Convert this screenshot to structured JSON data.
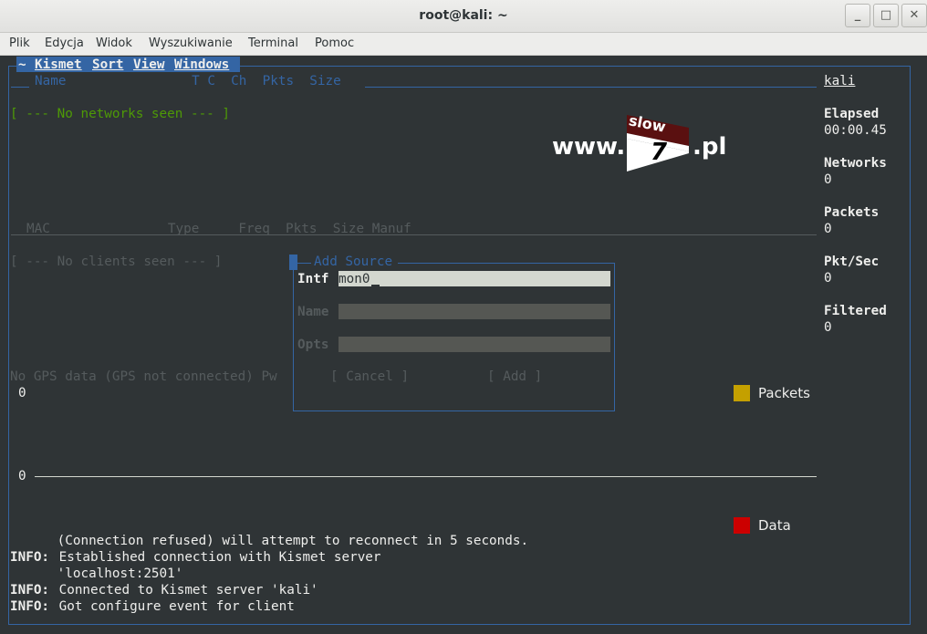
{
  "window": {
    "title": "root@kali: ~",
    "buttons": [
      "_",
      "□",
      "✕"
    ]
  },
  "menu": [
    "Plik",
    "Edycja",
    "Widok",
    "Wyszukiwanie",
    "Terminal",
    "Pomoc"
  ],
  "kismet": {
    "menubar": "~ Kismet Sort View Windows",
    "menu_items": [
      "~",
      "Kismet",
      "Sort",
      "View",
      "Windows"
    ],
    "network_headers": "Name                T C  Ch  Pkts  Size",
    "no_networks": "[ --- No networks seen --- ]",
    "client_headers": "MAC               Type     Freq  Pkts  Size Manuf",
    "no_clients": "[ --- No clients seen --- ]",
    "gps": "No GPS data (GPS not connected) Pw",
    "graph": {
      "top_value": "0",
      "bottom_value": "0",
      "legend": [
        {
          "label": "Packets",
          "color": "#c4a000"
        },
        {
          "label": "Data",
          "color": "#cc0000"
        }
      ]
    },
    "sidebar": {
      "host": "kali",
      "stats": [
        {
          "label": "Elapsed",
          "value": "00:00.45"
        },
        {
          "label": "Networks",
          "value": "0"
        },
        {
          "label": "Packets",
          "value": "0"
        },
        {
          "label": "Pkt/Sec",
          "value": "0"
        },
        {
          "label": "Filtered",
          "value": "0"
        }
      ]
    },
    "dialog": {
      "title": "Add Source",
      "fields": [
        {
          "label": "Intf",
          "value": "mon0"
        },
        {
          "label": "Name",
          "value": ""
        },
        {
          "label": "Opts",
          "value": ""
        }
      ],
      "cancel": "[ Cancel ]",
      "add": "[ Add ]"
    },
    "log": [
      {
        "prefix": "",
        "text": "      (Connection refused) will attempt to reconnect in 5 seconds."
      },
      {
        "prefix": "INFO:",
        "text": " Established connection with Kismet server"
      },
      {
        "prefix": "",
        "text": "      'localhost:2501'"
      },
      {
        "prefix": "INFO:",
        "text": " Connected to Kismet server 'kali'"
      },
      {
        "prefix": "INFO:",
        "text": " Got configure event for client"
      }
    ]
  },
  "watermark": {
    "left": "www.",
    "box_top": "slow",
    "box_bottom": "7",
    "right": ".pl"
  }
}
